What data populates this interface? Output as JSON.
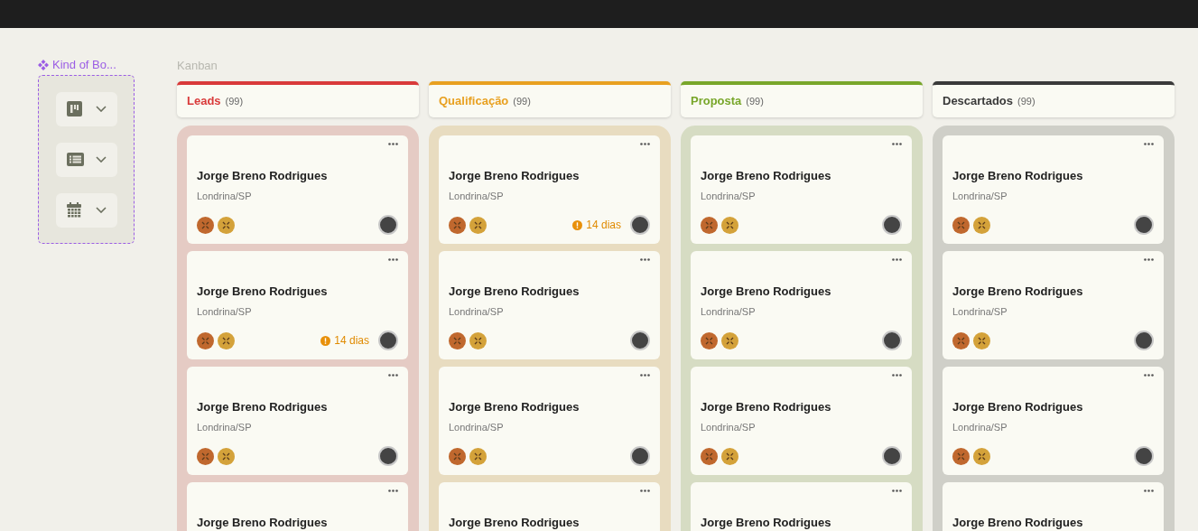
{
  "sidebar": {
    "title": "Kind of Bo...",
    "views": [
      {
        "kind": "board"
      },
      {
        "kind": "list"
      },
      {
        "kind": "calendar"
      }
    ]
  },
  "board": {
    "title": "Kanban",
    "columns": [
      {
        "title": "Leads",
        "count": "(99)",
        "color": "#d93a3a",
        "cards": [
          {
            "name": "Jorge Breno Rodrigues",
            "location": "Londrina/SP"
          },
          {
            "name": "Jorge Breno Rodrigues",
            "location": "Londrina/SP",
            "deadline": "14 dias"
          },
          {
            "name": "Jorge Breno Rodrigues",
            "location": "Londrina/SP"
          },
          {
            "name": "Jorge Breno Rodrigues"
          }
        ]
      },
      {
        "title": "Qualificação",
        "count": "(99)",
        "color": "#e8a020",
        "cards": [
          {
            "name": "Jorge Breno Rodrigues",
            "location": "Londrina/SP",
            "deadline": "14 dias"
          },
          {
            "name": "Jorge Breno Rodrigues",
            "location": "Londrina/SP"
          },
          {
            "name": "Jorge Breno Rodrigues",
            "location": "Londrina/SP"
          },
          {
            "name": "Jorge Breno Rodrigues"
          }
        ]
      },
      {
        "title": "Proposta",
        "count": "(99)",
        "color": "#78a62a",
        "cards": [
          {
            "name": "Jorge Breno Rodrigues",
            "location": "Londrina/SP"
          },
          {
            "name": "Jorge Breno Rodrigues",
            "location": "Londrina/SP"
          },
          {
            "name": "Jorge Breno Rodrigues",
            "location": "Londrina/SP"
          },
          {
            "name": "Jorge Breno Rodrigues"
          }
        ]
      },
      {
        "title": "Descartados",
        "count": "(99)",
        "color": "#3a3a3a",
        "cards": [
          {
            "name": "Jorge Breno Rodrigues",
            "location": "Londrina/SP"
          },
          {
            "name": "Jorge Breno Rodrigues",
            "location": "Londrina/SP"
          },
          {
            "name": "Jorge Breno Rodrigues",
            "location": "Londrina/SP"
          },
          {
            "name": "Jorge Breno Rodrigues"
          }
        ]
      }
    ]
  }
}
